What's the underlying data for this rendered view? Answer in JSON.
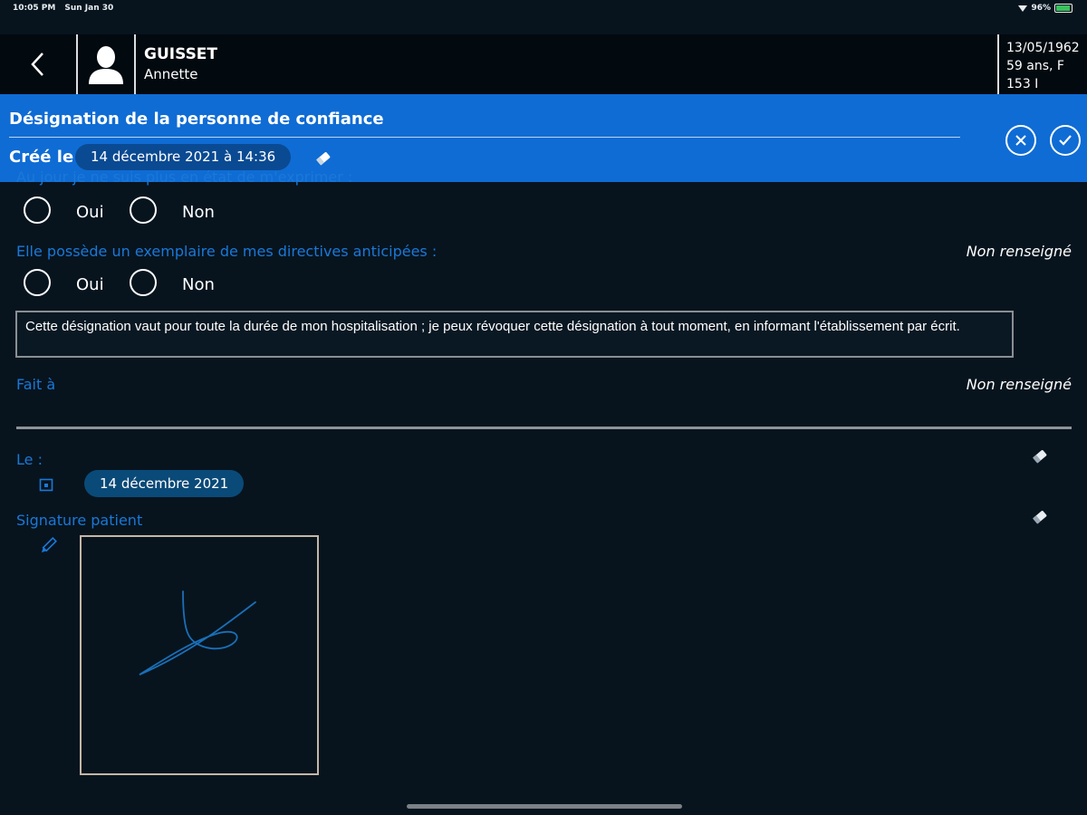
{
  "status_bar": {
    "time": "10:05 PM",
    "date": "Sun Jan 30",
    "battery": "96%"
  },
  "patient": {
    "last_name": "GUISSET",
    "first_name": "Annette",
    "birth_date": "13/05/1962",
    "age_sex": "59 ans, F",
    "ref": "153 I"
  },
  "form": {
    "title": "Désignation de la personne de confiance",
    "created_label": "Créé le",
    "created_value": "14 décembre 2021 à 14:36"
  },
  "questions": {
    "q1_partial": "Au jour je ne suis plus en état de m'exprimer :",
    "q1_options": [
      "Oui",
      "Non"
    ],
    "q2_label": "Elle possède un exemplaire de mes directives anticipées :",
    "q2_status": "Non renseigné",
    "q2_options": [
      "Oui",
      "Non"
    ]
  },
  "statement": "Cette désignation vaut pour toute la durée de mon hospitalisation ; je peux révoquer cette désignation à tout moment, en informant l'établissement par écrit.",
  "fait_a": {
    "label": "Fait à",
    "status": "Non renseigné"
  },
  "le": {
    "label": "Le :",
    "value": "14 décembre 2021"
  },
  "signature": {
    "label": "Signature patient"
  },
  "colors": {
    "accent": "#0f6cd4",
    "label_blue": "#1a78d8",
    "background": "#07141e"
  }
}
